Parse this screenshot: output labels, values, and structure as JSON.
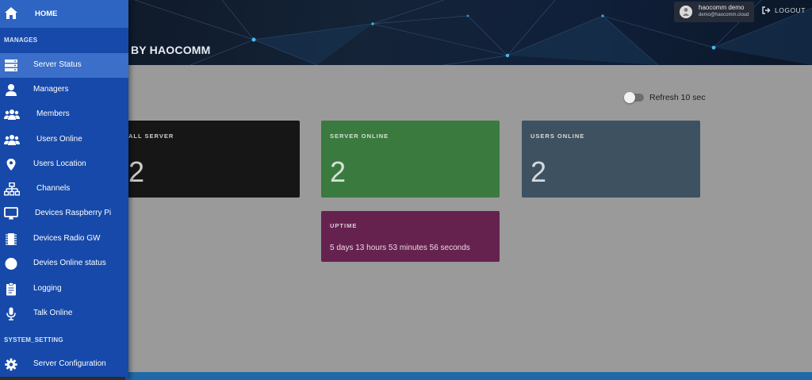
{
  "header": {
    "title": "BY HAOCOMM",
    "user": {
      "name": "haocomm demo",
      "email": "demo@haocomm.cloud",
      "avatar_icon": "user-avatar-icon"
    },
    "logout_label": "LOGOUT"
  },
  "sidebar": {
    "home_label": "HOME",
    "sections": {
      "manages": "MANAGES",
      "system_setting": "SYSTEM_SETTING"
    },
    "items": [
      {
        "label": "Server Status",
        "icon": "server-icon",
        "active": true
      },
      {
        "label": "Managers",
        "icon": "user-icon"
      },
      {
        "label": "Members",
        "icon": "users-icon"
      },
      {
        "label": "Users Online",
        "icon": "users-icon"
      },
      {
        "label": "Users Location",
        "icon": "map-marker-icon"
      },
      {
        "label": "Channels",
        "icon": "sitemap-icon"
      },
      {
        "label": "Devices Raspberry Pi",
        "icon": "desktop-icon"
      },
      {
        "label": "Devices Radio GW",
        "icon": "microchip-icon"
      },
      {
        "label": "Devies Online status",
        "icon": "circle-icon"
      },
      {
        "label": "Logging",
        "icon": "clipboard-icon"
      },
      {
        "label": "Talk Online",
        "icon": "microphone-icon"
      }
    ],
    "settings_items": [
      {
        "label": "Server Configuration",
        "icon": "gear-icon"
      }
    ]
  },
  "main": {
    "refresh_label": "Refresh 10 sec",
    "refresh_enabled": false,
    "cards": {
      "all_server": {
        "label": "ALL SERVER",
        "value": "2",
        "color": "#161616"
      },
      "server_online": {
        "label": "SERVER ONLINE",
        "value": "2",
        "color": "#3a7a3e"
      },
      "users_online": {
        "label": "USERS ONLINE",
        "value": "2",
        "color": "#3d5161"
      },
      "uptime": {
        "label": "UPTIME",
        "value": "5 days 13 hours 53 minutes 56 seconds",
        "color": "#65224f"
      }
    }
  },
  "colors": {
    "sidebar": "#1649a9",
    "sidebar_active": "#3b6fc9",
    "accent_bar": "#1f6aa6"
  }
}
